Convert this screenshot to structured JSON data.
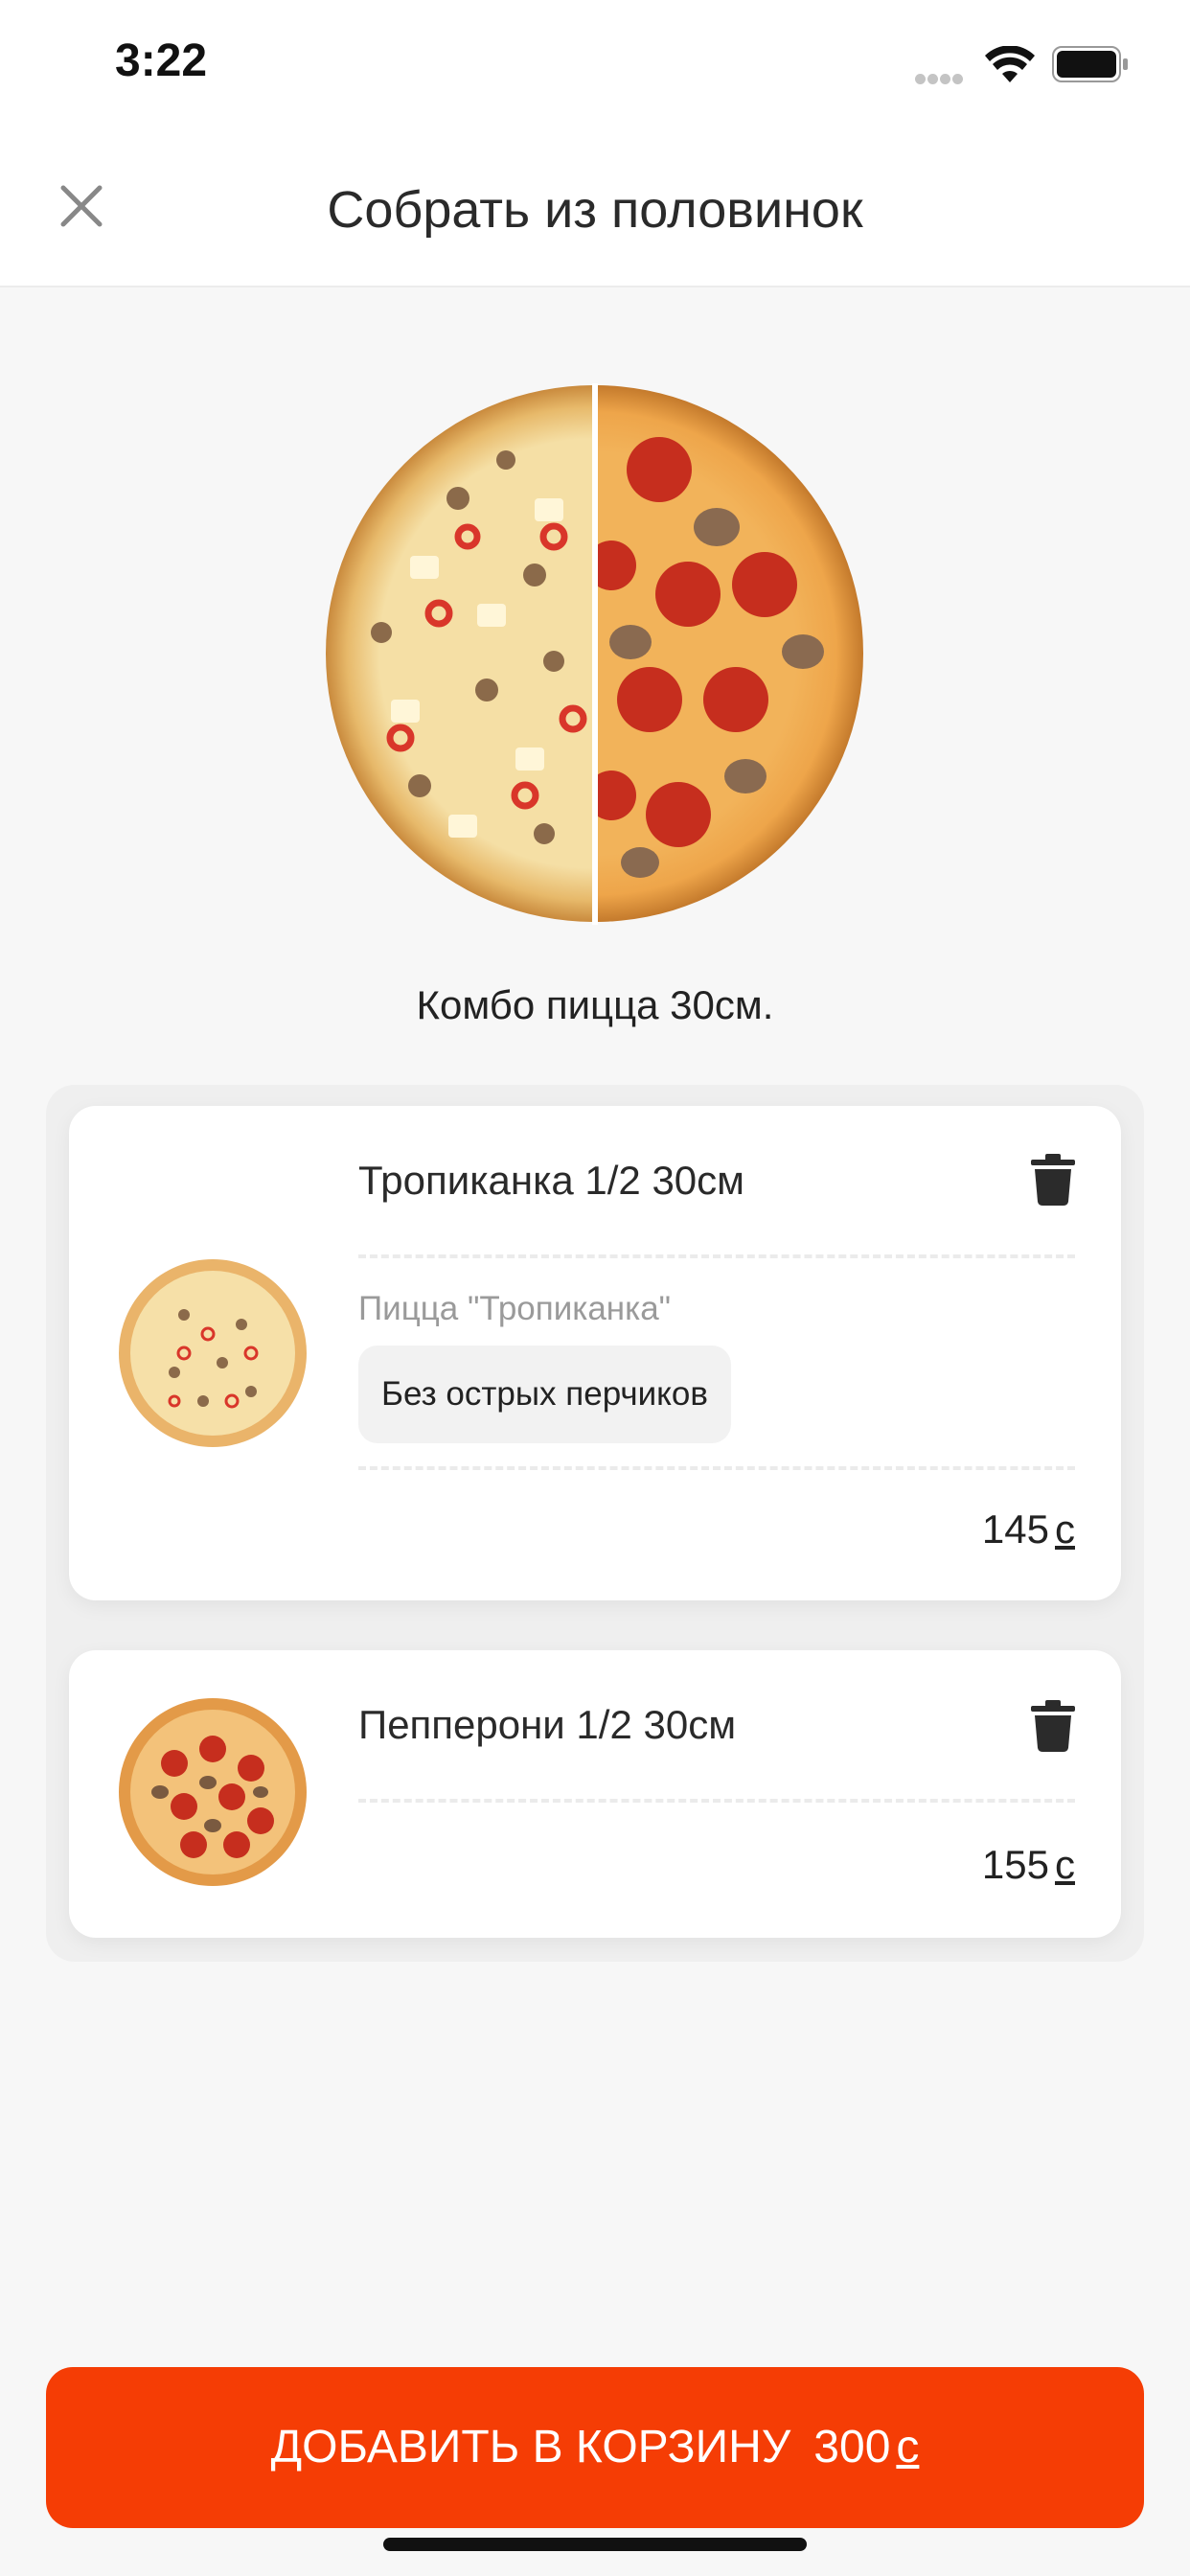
{
  "status_bar": {
    "time": "3:22",
    "icons": [
      "signal-dots-icon",
      "wifi-icon",
      "battery-icon"
    ]
  },
  "header": {
    "title": "Собрать из половинок",
    "close_icon": "close-icon"
  },
  "combo": {
    "title": "Комбо пицца 30см."
  },
  "items": [
    {
      "name": "Тропиканка 1/2 30см",
      "subtitle": "Пицца \"Тропиканка\"",
      "modifier": "Без острых перчиков",
      "price": "145",
      "currency": "с"
    },
    {
      "name": "Пепперони 1/2 30см",
      "price": "155",
      "currency": "с"
    }
  ],
  "add_to_cart": {
    "label": "ДОБАВИТЬ В КОРЗИНУ",
    "price": "300",
    "currency": "с"
  },
  "colors": {
    "accent": "#f53d05",
    "background": "#f7f7f7",
    "card": "#ffffff"
  }
}
